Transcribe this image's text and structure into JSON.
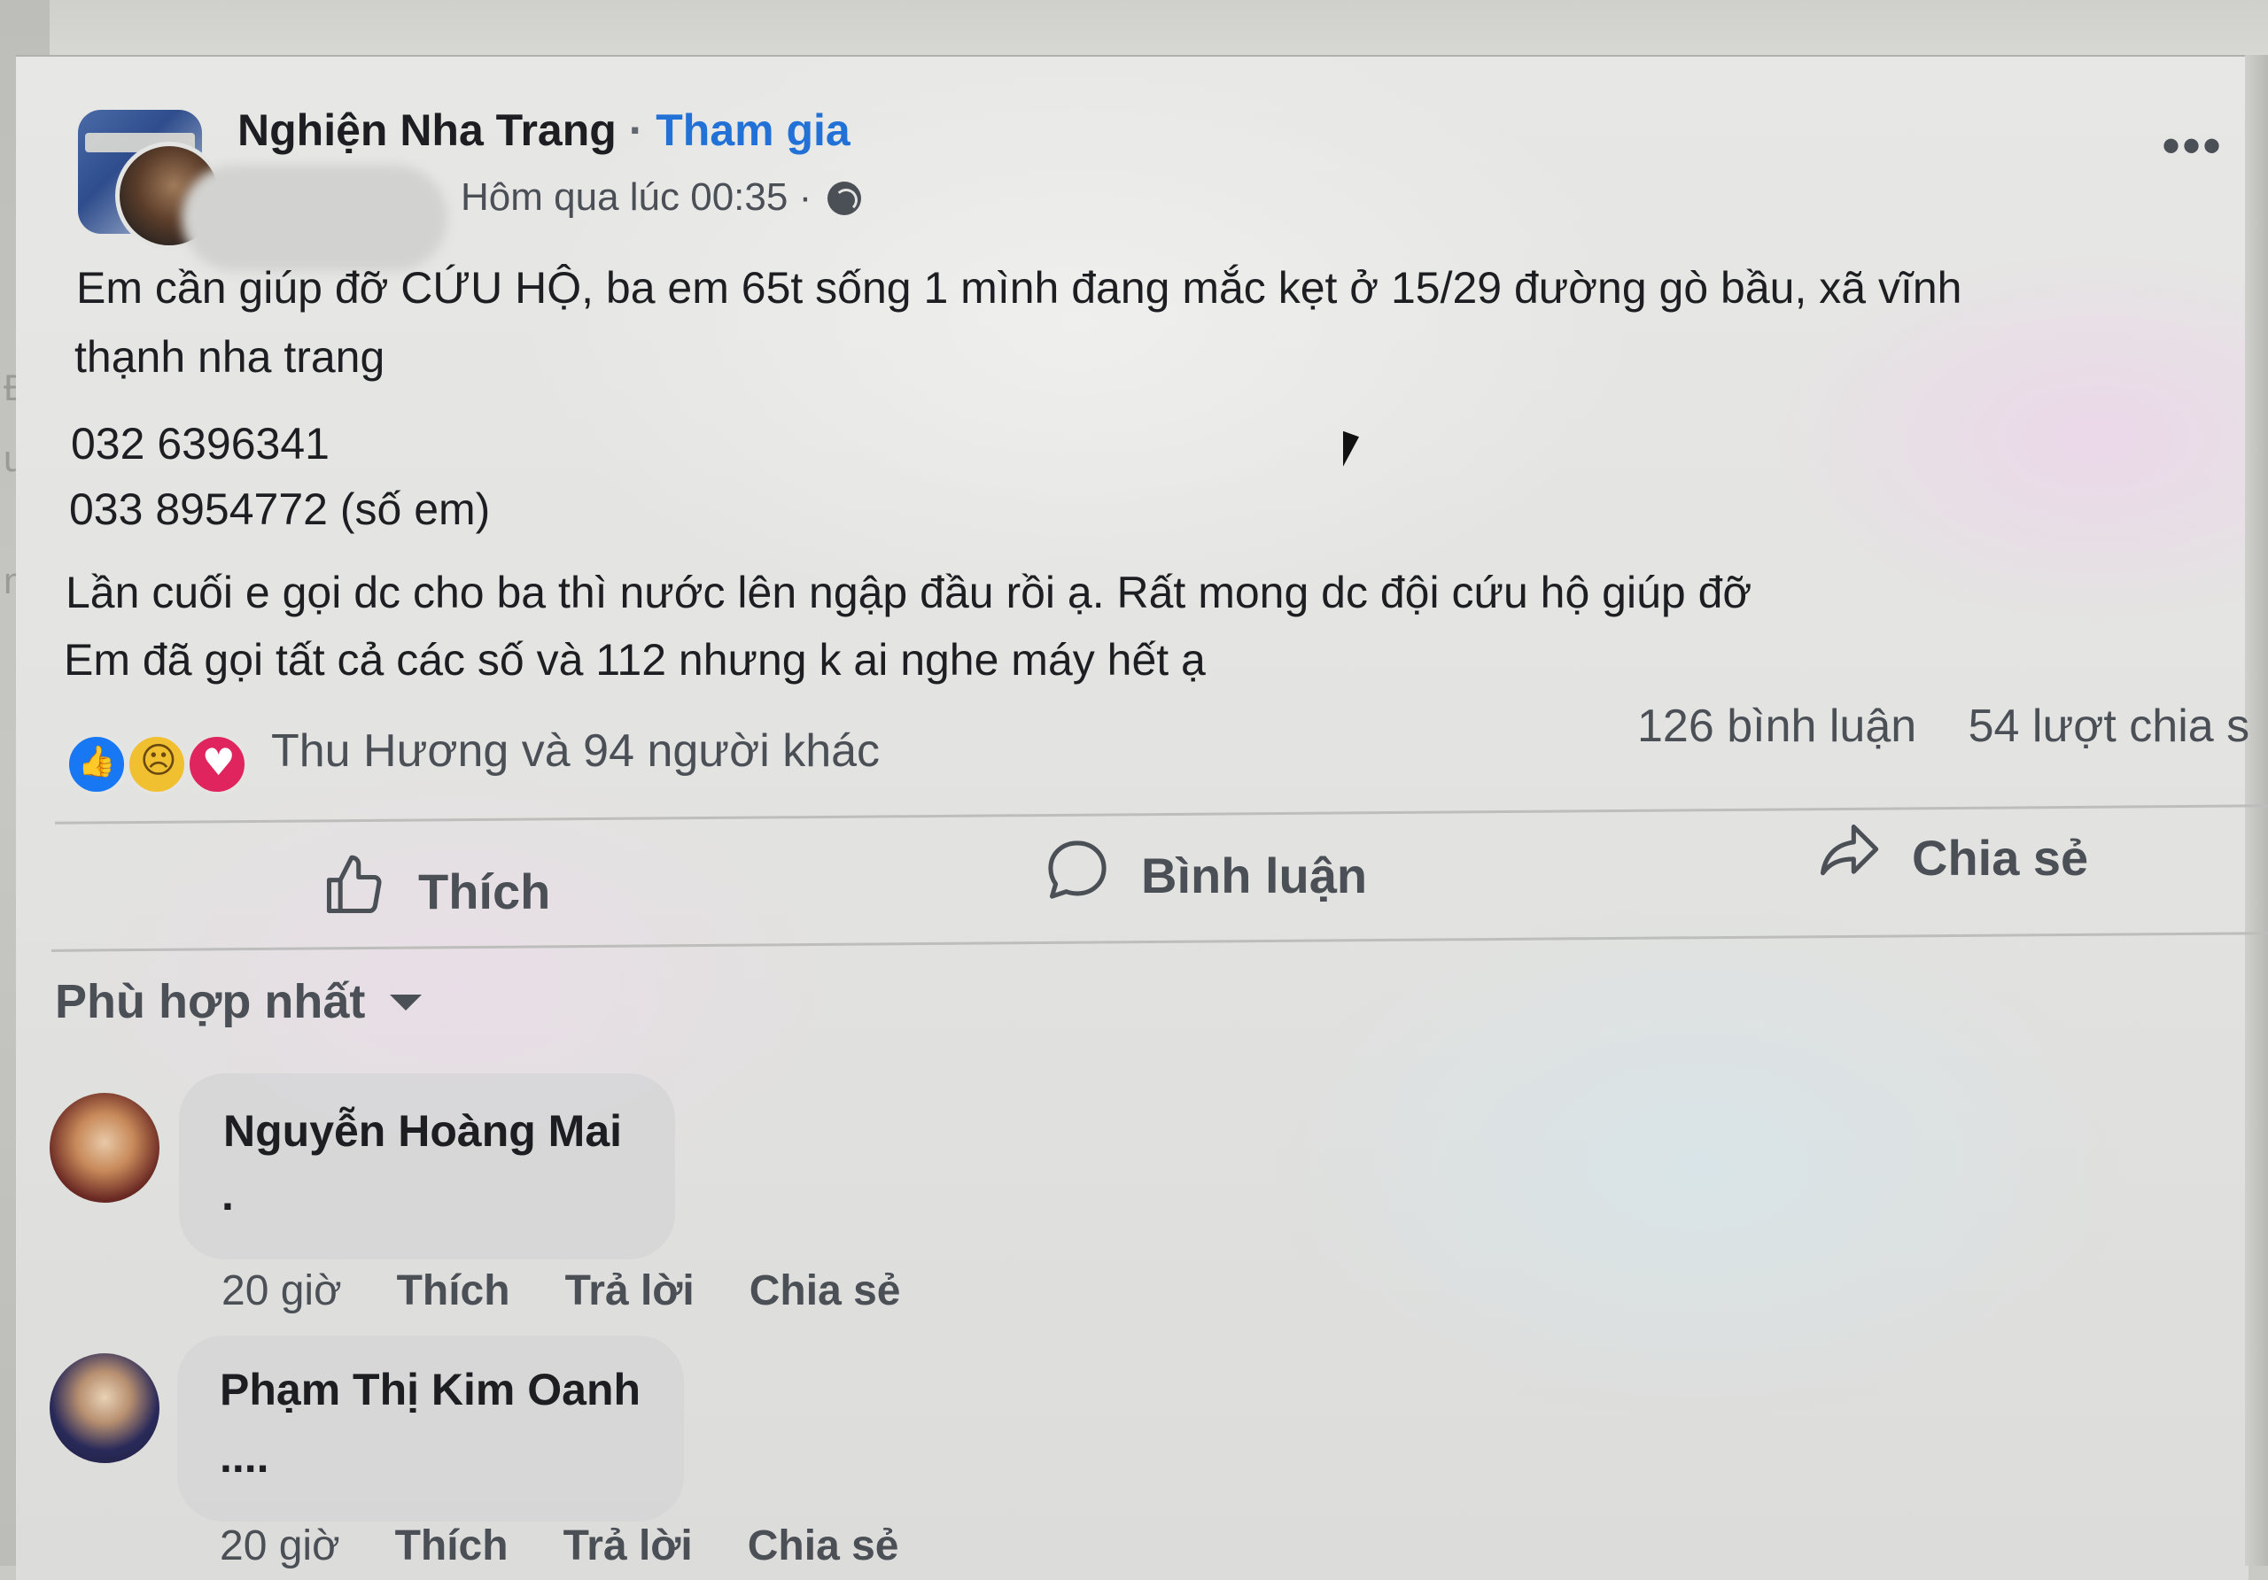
{
  "post": {
    "group_name": "Nghiện Nha Trang",
    "separator": " · ",
    "join_label": "Tham gia",
    "timestamp": "Hôm qua lúc 00:35 ·",
    "more_label": "•••",
    "body": {
      "line1": "Em cần giúp đỡ CỨU HỘ, ba em 65t sống 1 mình đang mắc kẹt ở 15/29 đường gò bầu, xã vĩnh",
      "line2": "thạnh nha trang",
      "phone1": "032 6396341",
      "phone2": "033 8954772 (số em)",
      "line3": "Lần cuối e gọi dc cho ba thì nước lên ngập đầu rồi ạ. Rất mong dc đội cứu hộ giúp đỡ",
      "line4": "Em đã gọi tất cả các số và 112 nhưng k ai nghe máy hết ạ"
    },
    "reactions": {
      "icons": [
        "like-icon",
        "sad-icon",
        "love-icon"
      ],
      "summary": "Thu Hương và 94 người khác",
      "comments_count": "126 bình luận",
      "shares_count": "54 lượt chia s"
    },
    "actions": {
      "like": "Thích",
      "comment": "Bình luận",
      "share": "Chia sẻ"
    }
  },
  "comments": {
    "sort_label": "Phù hợp nhất",
    "items": [
      {
        "author": "Nguyễn Hoàng Mai",
        "text": ".",
        "time": "20 giờ",
        "like": "Thích",
        "reply": "Trả lời",
        "share": "Chia sẻ"
      },
      {
        "author": "Phạm Thị Kim Oanh",
        "text": "....",
        "time": "20 giờ",
        "like": "Thích",
        "reply": "Trả lời",
        "share": "Chia sẻ"
      }
    ]
  },
  "side_fragments": [
    "Đ",
    "u",
    "n"
  ],
  "colors": {
    "link_blue": "#2271d6",
    "like_blue": "#1877f2",
    "love_red": "#e0245e",
    "sad_yellow": "#f0c030"
  }
}
